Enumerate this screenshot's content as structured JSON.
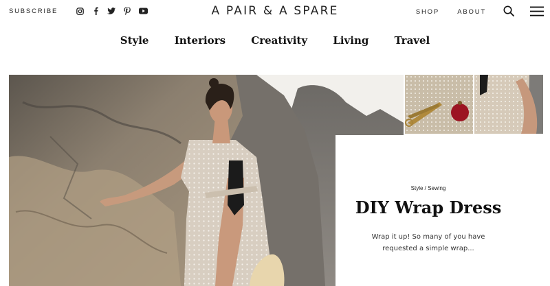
{
  "header": {
    "subscribe": "SUBSCRIBE",
    "logo": "A PAIR & A SPARE",
    "shop": "SHOP",
    "about": "ABOUT",
    "social_icons": [
      "instagram-icon",
      "facebook-icon",
      "twitter-icon",
      "pinterest-icon",
      "youtube-icon"
    ]
  },
  "categories": [
    "Style",
    "Interiors",
    "Creativity",
    "Living",
    "Travel"
  ],
  "feature": {
    "category": "Style",
    "subcategory": "Sewing",
    "separator": " / ",
    "title": "DIY Wrap Dress",
    "excerpt": "Wrap it up! So many of you have requested a simple wrap..."
  },
  "colors": {
    "text": "#111111",
    "rock": "#8a7e6f",
    "dress": "#d9cfc2",
    "sky": "#f3f1ee"
  }
}
